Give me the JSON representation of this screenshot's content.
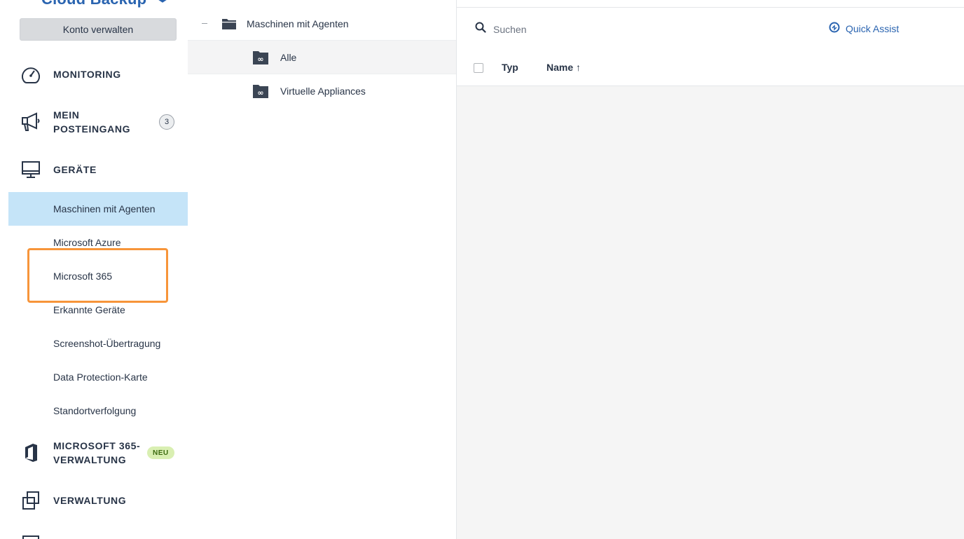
{
  "sidebar": {
    "logo_text": "Cloud Backup",
    "manage_account": "Konto verwalten",
    "nav": {
      "monitoring": "MONITORING",
      "inbox_line1": "MEIN",
      "inbox_line2": "POSTEINGANG",
      "inbox_count": "3",
      "devices": "GERÄTE",
      "m365_line1": "MICROSOFT 365-",
      "m365_line2": "VERWALTUNG",
      "m365_badge": "NEU",
      "management": "VERWALTUNG"
    },
    "devices_sub": [
      "Maschinen mit Agenten",
      "Microsoft Azure",
      "Microsoft 365",
      "Erkannte Geräte",
      "Screenshot-Übertragung",
      "Data Protection-Karte",
      "Standortverfolgung"
    ],
    "active_sub_index": 0,
    "highlighted_sub_index": 2
  },
  "tree": {
    "root": "Maschinen mit Agenten",
    "children": [
      "Alle",
      "Virtuelle Appliances"
    ],
    "selected_index": 0
  },
  "main": {
    "search_placeholder": "Suchen",
    "quick_assist": "Quick Assist",
    "columns": [
      "Typ",
      "Name ↑"
    ]
  },
  "colors": {
    "accent": "#2a64b0",
    "active_bg": "#c5e4f8",
    "highlight": "#f7953a",
    "new_badge_bg": "#d9efb2"
  }
}
